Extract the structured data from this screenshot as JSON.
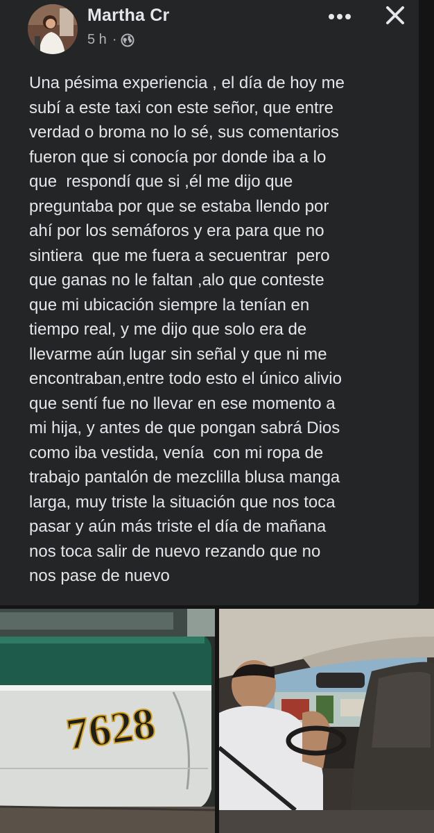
{
  "post": {
    "author_name": "Martha Cr",
    "time": "5 h",
    "separator": "·",
    "privacy_icon": "globe-icon",
    "text": "Una pésima experiencia , el día de hoy me\nsubí a este taxi con este señor, que entre\nverdad o broma no lo sé, sus comentarios\nfueron que si conocía por donde iba a lo\nque  respondí que si ,él me dijo que\npreguntaba por que se estaba llendo por\nahí por los semáforos y era para que no\nsintiera  que me fuera a secuentrar  pero\nque ganas no le faltan ,alo que conteste\nque mi ubicación siempre la tenían en\ntiempo real, y me dijo que solo era de\nllevarme aún lugar sin señal y que ni me\nencontraban,entre todo esto el único alivio\nque sentí fue no llevar en ese momento a\nmi hija, y antes de que pongan sabrá Dios\ncomo iba vestida, venía  con mi ropa de\ntrabajo pantalón de mezclilla blusa manga\nlarga, muy triste la situación que nos toca\npasar y aún más triste el día de mañana\nnos toca salir de nuevo rezando que no\nnos pase de nuevo"
  },
  "header_actions": {
    "more_icon": "more-options-icon",
    "close_icon": "close-icon"
  },
  "photos": {
    "left_taxi_number": "7628"
  },
  "colors": {
    "background": "#141414",
    "card": "#242526",
    "text_primary": "#e4e6eb",
    "text_secondary": "#b0b3b8"
  }
}
